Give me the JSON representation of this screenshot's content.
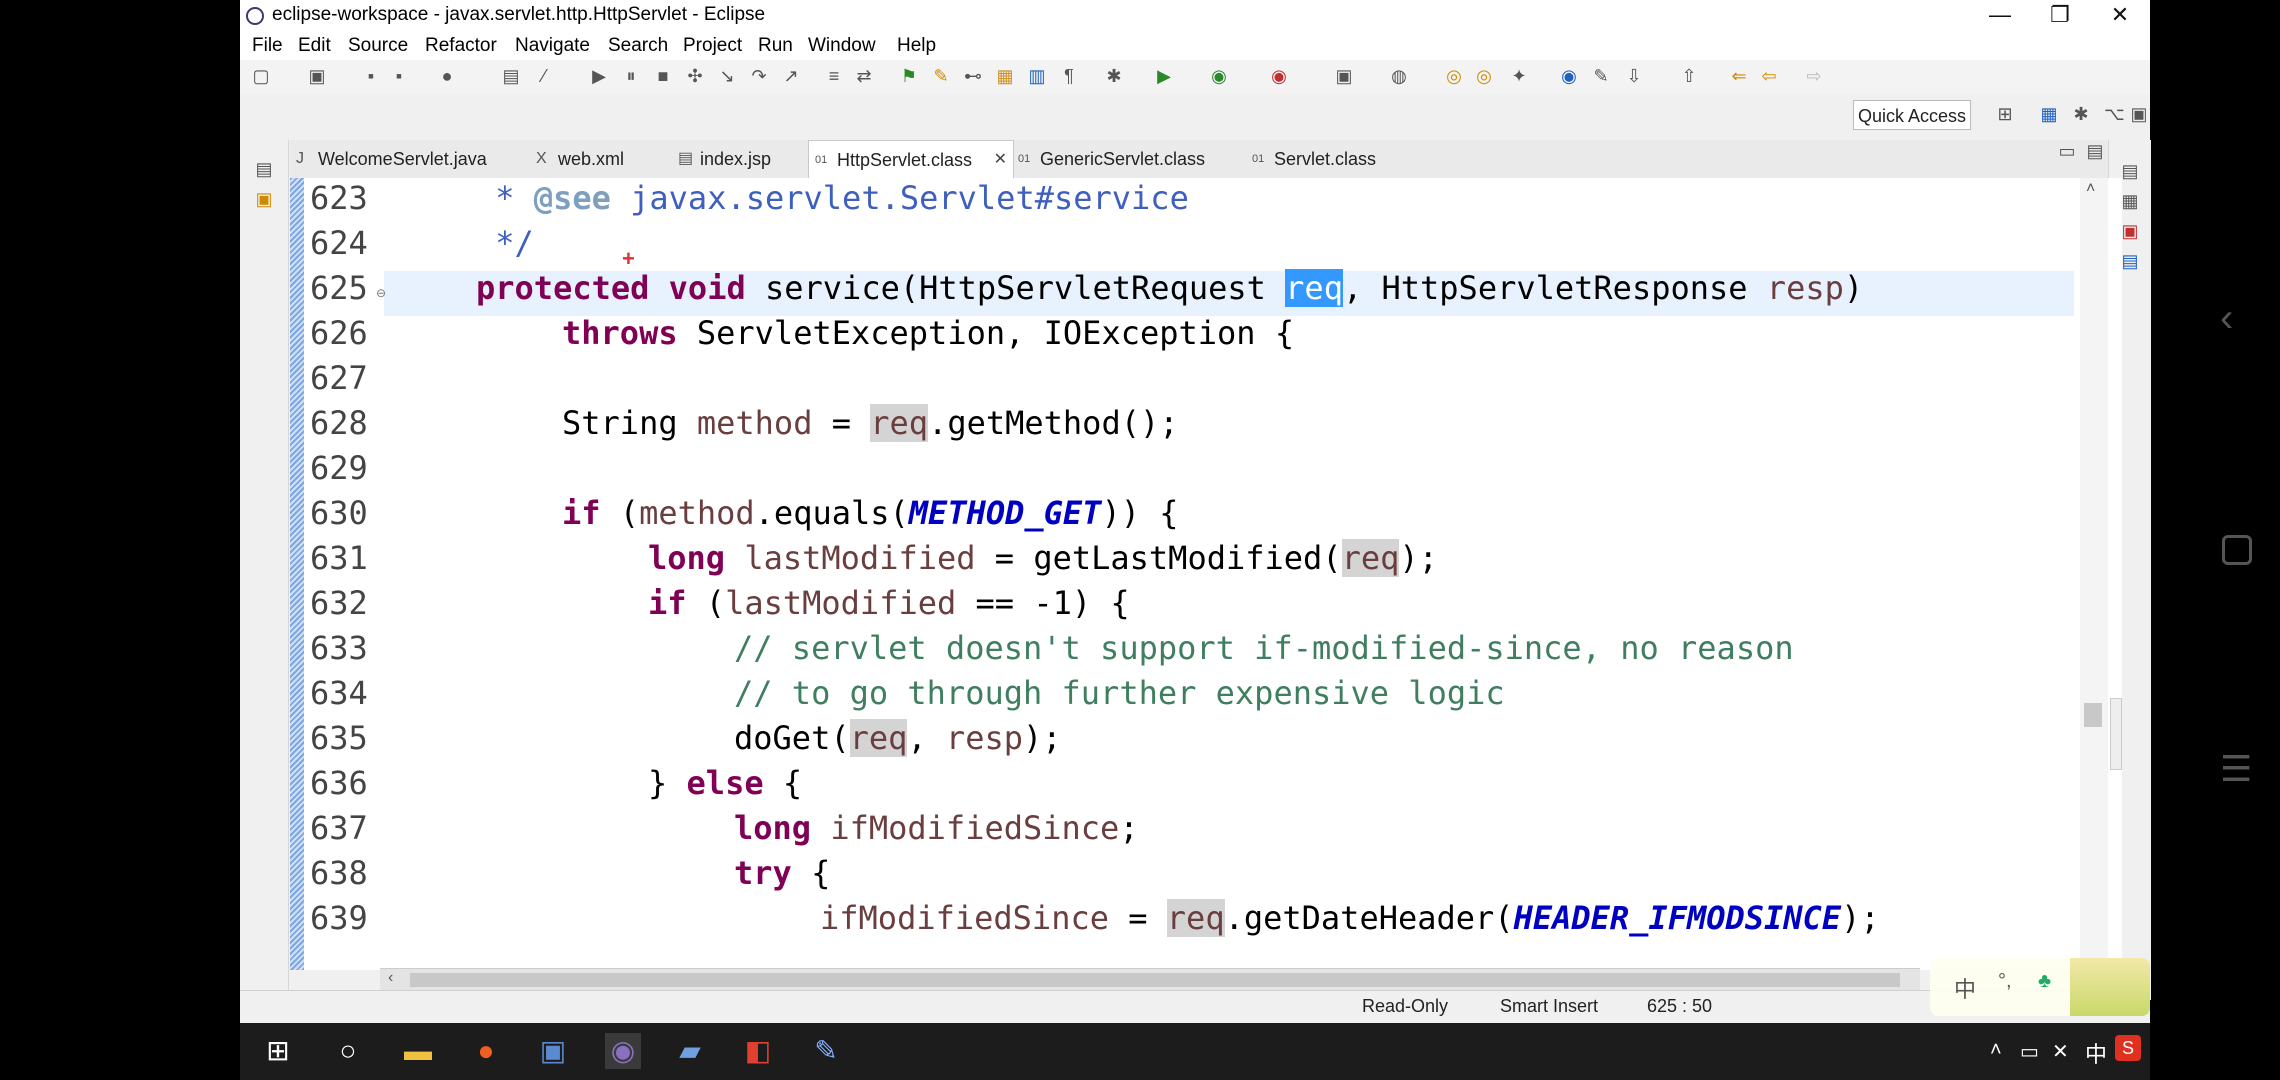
{
  "window": {
    "title": "eclipse-workspace - javax.servlet.http.HttpServlet - Eclipse",
    "controls": [
      "—",
      "❐",
      "✕"
    ]
  },
  "menu": [
    "File",
    "Edit",
    "Source",
    "Refactor",
    "Navigate",
    "Search",
    "Project",
    "Run",
    "Window",
    "Help"
  ],
  "quick_access": "Quick Access",
  "tabs": [
    {
      "label": "WelcomeServlet.java",
      "icon": "J"
    },
    {
      "label": "web.xml",
      "icon": "X"
    },
    {
      "label": "index.jsp",
      "icon": "▤"
    },
    {
      "label": "HttpServlet.class",
      "icon": "01",
      "active": true,
      "close": "✕"
    },
    {
      "label": "GenericServlet.class",
      "icon": "01"
    },
    {
      "label": "Servlet.class",
      "icon": "01"
    }
  ],
  "lines": {
    "n623": "623",
    "n624": "624",
    "n625": "625",
    "n626": "626",
    "n627": "627",
    "n628": "628",
    "n629": "629",
    "n630": "630",
    "n631": "631",
    "n632": "632",
    "n633": "633",
    "n634": "634",
    "n635": "635",
    "n636": "636",
    "n637": "637",
    "n638": "638",
    "n639": "639"
  },
  "code": {
    "l623_star": " * ",
    "l623_tag": "@see",
    "l623_ref": " javax.servlet.Servlet#service",
    "l624": " */",
    "l625_kw": "protected void",
    "l625_a": " service(HttpServletRequest ",
    "l625_sel": "req",
    "l625_b": ", HttpServletResponse ",
    "l625_var": "resp",
    "l625_c": ")",
    "l626_kw": "throws",
    "l626_a": " ServletException, IOException {",
    "l628_a": "String ",
    "l628_var": "method",
    "l628_b": " = ",
    "l628_occ": "req",
    "l628_c": ".getMethod();",
    "l630_kw": "if",
    "l630_a": " (",
    "l630_var": "method",
    "l630_b": ".equals(",
    "l630_cst": "METHOD_GET",
    "l630_c": ")) {",
    "l631_kw": "long",
    "l631_a": " ",
    "l631_var": "lastModified",
    "l631_b": " = getLastModified(",
    "l631_occ": "req",
    "l631_c": ");",
    "l632_kw": "if",
    "l632_a": " (",
    "l632_var": "lastModified",
    "l632_b": " == -1) {",
    "l633": "// servlet doesn't support if-modified-since, no reason",
    "l634": "// to go through further expensive logic",
    "l635_a": "doGet(",
    "l635_occ": "req",
    "l635_b": ", ",
    "l635_var": "resp",
    "l635_c": ");",
    "l636_a": "} ",
    "l636_kw": "else",
    "l636_b": " {",
    "l637_kw": "long",
    "l637_a": " ",
    "l637_var": "ifModifiedSince",
    "l637_b": ";",
    "l638_kw": "try",
    "l638_a": " {",
    "l639_var": "ifModifiedSince",
    "l639_a": " = ",
    "l639_occ": "req",
    "l639_b": ".getDateHeader(",
    "l639_cst": "HEADER_IFMODSINCE",
    "l639_c": ");"
  },
  "status": {
    "mode": "Read-Only",
    "insert": "Smart Insert",
    "position": "625 : 50"
  },
  "ime": {
    "a": "中",
    "b": "°,"
  },
  "tray": {
    "lang": "中"
  }
}
